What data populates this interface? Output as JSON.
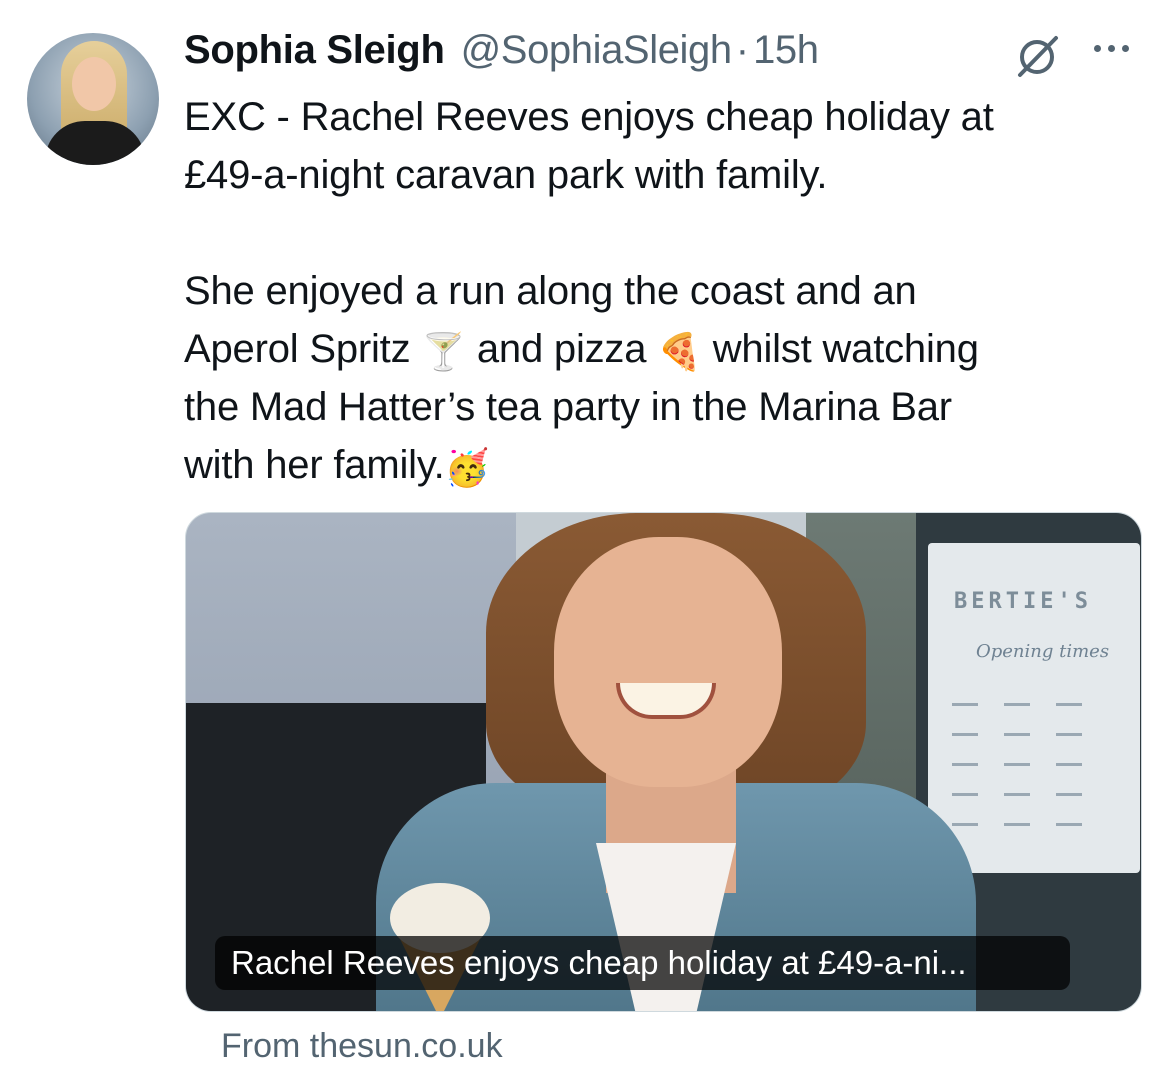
{
  "author": {
    "name": "Sophia Sleigh",
    "handle": "@SophiaSleigh",
    "separator": "·",
    "time": "15h"
  },
  "icons": {
    "grok": "grok-icon",
    "more": "more-options-icon"
  },
  "tweet": {
    "paragraph1": [
      "EXC - Rachel Reeves enjoys cheap holiday at",
      "£49-a-night caravan park with family."
    ],
    "paragraph2": {
      "line1": "She enjoyed a run along the coast and an",
      "line2_a": "Aperol Spritz ",
      "line2_emoji1": "🍸",
      "line2_b": " and pizza ",
      "line2_emoji2": "🍕",
      "line2_c": " whilst watching",
      "line3": "the Mad Hatter’s tea party in the Marina Bar",
      "line4_a": "with her family.",
      "line4_emoji": "🥳"
    }
  },
  "card": {
    "caption": "Rachel Reeves enjoys cheap holiday at £49-a-ni...",
    "sign_title": "BERTIE'S",
    "sign_subtitle": "Opening times",
    "source": "From thesun.co.uk"
  }
}
